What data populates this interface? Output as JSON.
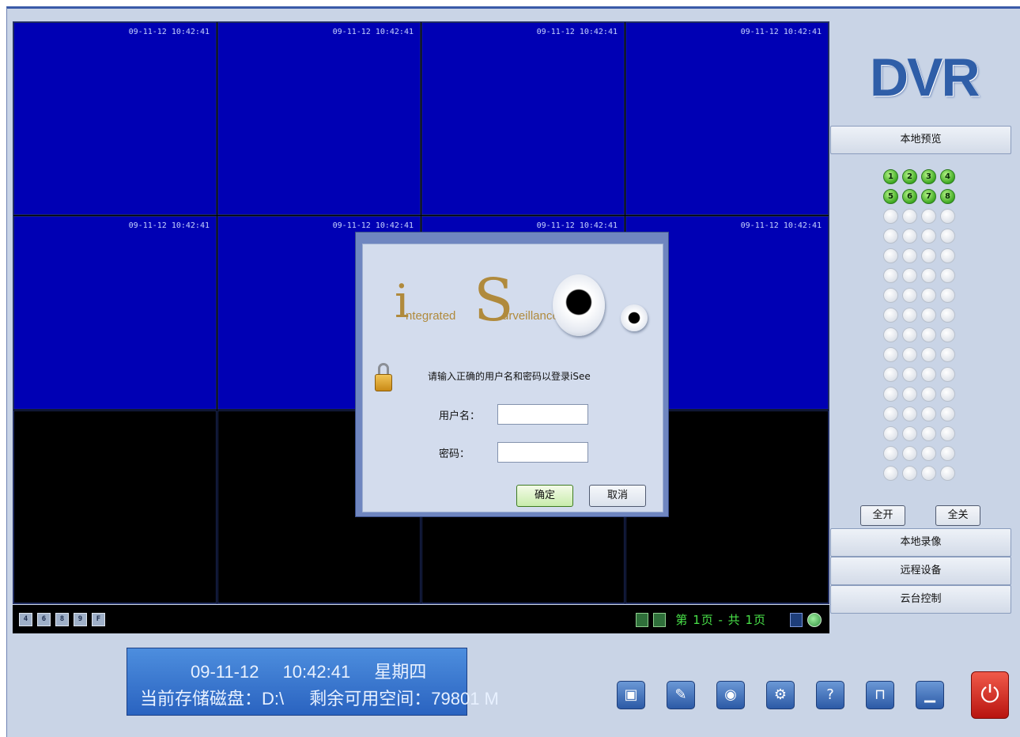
{
  "video": {
    "cells": [
      {
        "ts": "09-11-12 10:42:41",
        "blue": true
      },
      {
        "ts": "09-11-12 10:42:41",
        "blue": true
      },
      {
        "ts": "09-11-12 10:42:41",
        "blue": true
      },
      {
        "ts": "09-11-12 10:42:41",
        "blue": true
      },
      {
        "ts": "09-11-12 10:42:41",
        "blue": true
      },
      {
        "ts": "09-11-12 10:42:41",
        "blue": true
      },
      {
        "ts": "09-11-12 10:42:41",
        "blue": true
      },
      {
        "ts": "09-11-12 10:42:41",
        "blue": true
      },
      {
        "ts": "",
        "blue": false
      },
      {
        "ts": "",
        "blue": false
      },
      {
        "ts": "",
        "blue": false
      },
      {
        "ts": "",
        "blue": false
      }
    ],
    "layout_buttons": [
      "4",
      "6",
      "8",
      "9",
      "F"
    ],
    "pager_text": "第 1页 - 共 1页"
  },
  "sidebar": {
    "logo": "DVR",
    "local_preview": "本地预览",
    "channels_on": [
      "1",
      "2",
      "3",
      "4",
      "5",
      "6",
      "7",
      "8"
    ],
    "open_all": "全开",
    "close_all": "全关",
    "local_record": "本地录像",
    "remote_device": "远程设备",
    "ptz_control": "云台控制"
  },
  "status": {
    "date": "09-11-12",
    "time": "10:42:41",
    "weekday": "星期四",
    "disk": "当前存储磁盘：D:\\",
    "space": "剩余可用空间：79801 M"
  },
  "dialog": {
    "logo_i": "i",
    "logo_integrated": "ntegrated",
    "logo_s": "S",
    "logo_surveillance": "urveillance",
    "prompt": "请输入正确的用户名和密码以登录iSee",
    "username_label": "用户名：",
    "password_label": "密码：",
    "ok": "确定",
    "cancel": "取消"
  },
  "toolbar": {
    "icons": [
      "camera-icon",
      "pencil-icon",
      "film-icon",
      "settings-icon",
      "help-icon",
      "lock-icon",
      "minimize-icon",
      "power-icon"
    ]
  },
  "colors": {
    "video_blue": "#0000b4",
    "channel_active": "#3faa22",
    "accent": "#2c5aa6",
    "pager_green": "#48e048"
  }
}
